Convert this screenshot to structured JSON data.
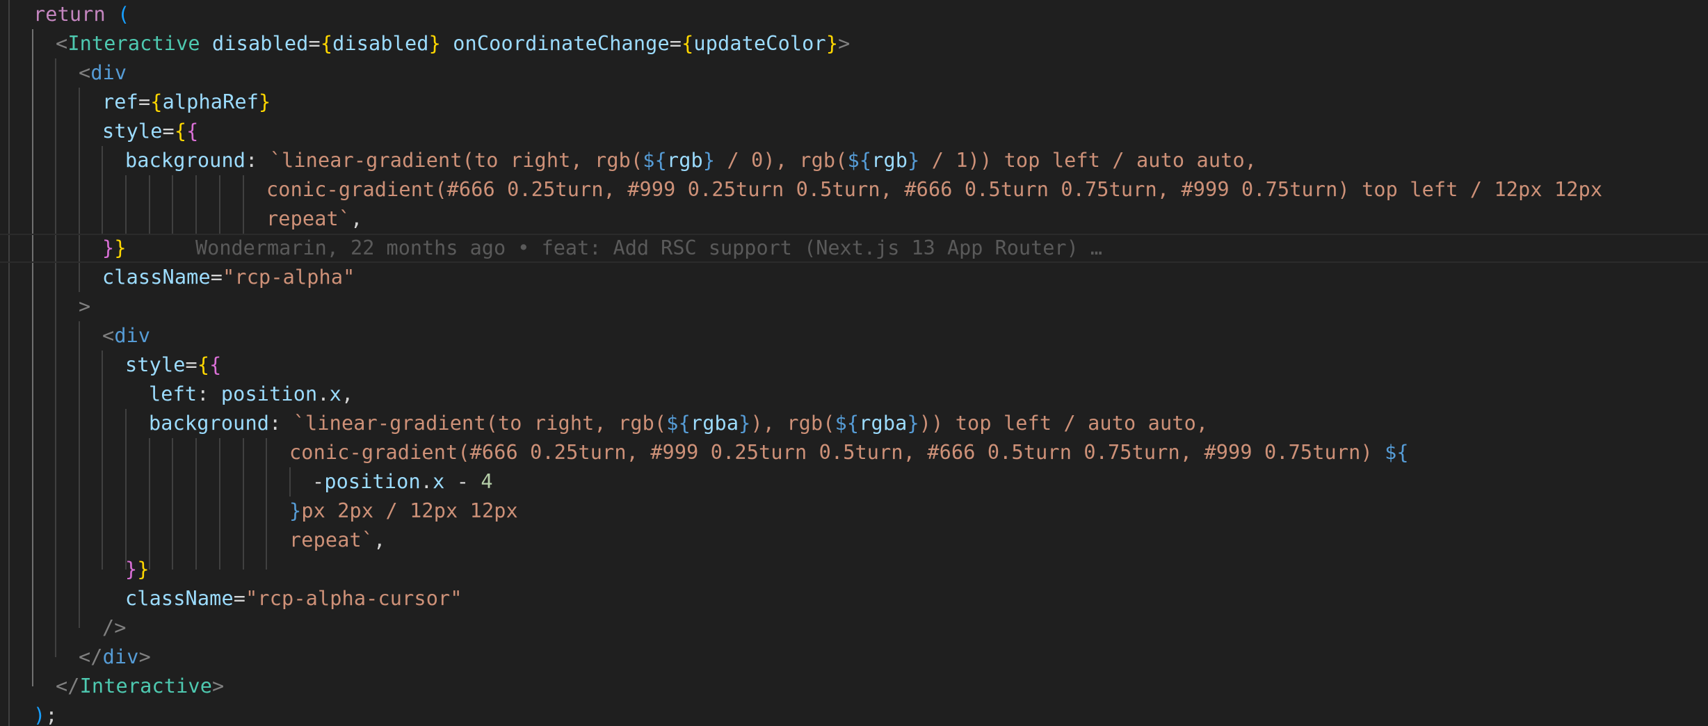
{
  "editor": {
    "blame": "Wondermarin, 22 months ago • feat: Add RSC support (Next.js 13 App Router) …",
    "code": {
      "l1": {
        "t1": "return",
        "t2": " ("
      },
      "l2": {
        "t1": "<",
        "t2": "Interactive",
        "t3": " disabled",
        "t4": "=",
        "t5": "{",
        "t6": "disabled",
        "t7": "}",
        "t8": " onCoordinateChange",
        "t9": "=",
        "t10": "{",
        "t11": "updateColor",
        "t12": "}",
        "t13": ">"
      },
      "l3": {
        "t1": "<",
        "t2": "div"
      },
      "l4": {
        "t1": "ref",
        "t2": "=",
        "t3": "{",
        "t4": "alphaRef",
        "t5": "}"
      },
      "l5": {
        "t1": "style",
        "t2": "=",
        "t3": "{",
        "t4": "{"
      },
      "l6": {
        "t1": "background",
        "t2": ": ",
        "t3": "`linear-gradient(to right, rgb(",
        "t4": "${",
        "t5": "rgb",
        "t6": "}",
        "t7": " / 0), rgb(",
        "t8": "${",
        "t9": "rgb",
        "t10": "}",
        "t11": " / 1)) top left / auto auto,"
      },
      "l7": {
        "t1": "conic-gradient(#666 0.25turn, #999 0.25turn 0.5turn, #666 0.5turn 0.75turn, #999 0.75turn) top left / 12px 12px"
      },
      "l8": {
        "t1": "repeat`",
        "t2": ","
      },
      "l9": {
        "t1": "}",
        "t2": "}"
      },
      "l10": {
        "t1": "className",
        "t2": "=",
        "t3": "\"rcp-alpha\""
      },
      "l11": {
        "t1": ">"
      },
      "l12": {
        "t1": "<",
        "t2": "div"
      },
      "l13": {
        "t1": "style",
        "t2": "=",
        "t3": "{",
        "t4": "{"
      },
      "l14": {
        "t1": "left",
        "t2": ": ",
        "t3": "position",
        "t4": ".",
        "t5": "x",
        "t6": ","
      },
      "l15": {
        "t1": "background",
        "t2": ": ",
        "t3": "`linear-gradient(to right, rgb(",
        "t4": "${",
        "t5": "rgba",
        "t6": "}",
        "t7": "), rgb(",
        "t8": "${",
        "t9": "rgba",
        "t10": "}",
        "t11": ")) top left / auto auto,"
      },
      "l16": {
        "t1": "conic-gradient(#666 0.25turn, #999 0.25turn 0.5turn, #666 0.5turn 0.75turn, #999 0.75turn) ",
        "t2": "${"
      },
      "l17": {
        "t1": "-",
        "t2": "position",
        "t3": ".",
        "t4": "x",
        "t5": " - ",
        "t6": "4"
      },
      "l18": {
        "t1": "}",
        "t2": "px 2px / 12px 12px"
      },
      "l19": {
        "t1": "repeat`",
        "t2": ","
      },
      "l20": {
        "t1": "}",
        "t2": "}"
      },
      "l21": {
        "t1": "className",
        "t2": "=",
        "t3": "\"rcp-alpha-cursor\""
      },
      "l22": {
        "t1": "/>"
      },
      "l23": {
        "t1": "</",
        "t2": "div",
        "t3": ">"
      },
      "l24": {
        "t1": "</",
        "t2": "Interactive",
        "t3": ">"
      },
      "l25": {
        "t1": ")",
        "t2": ";"
      }
    }
  }
}
